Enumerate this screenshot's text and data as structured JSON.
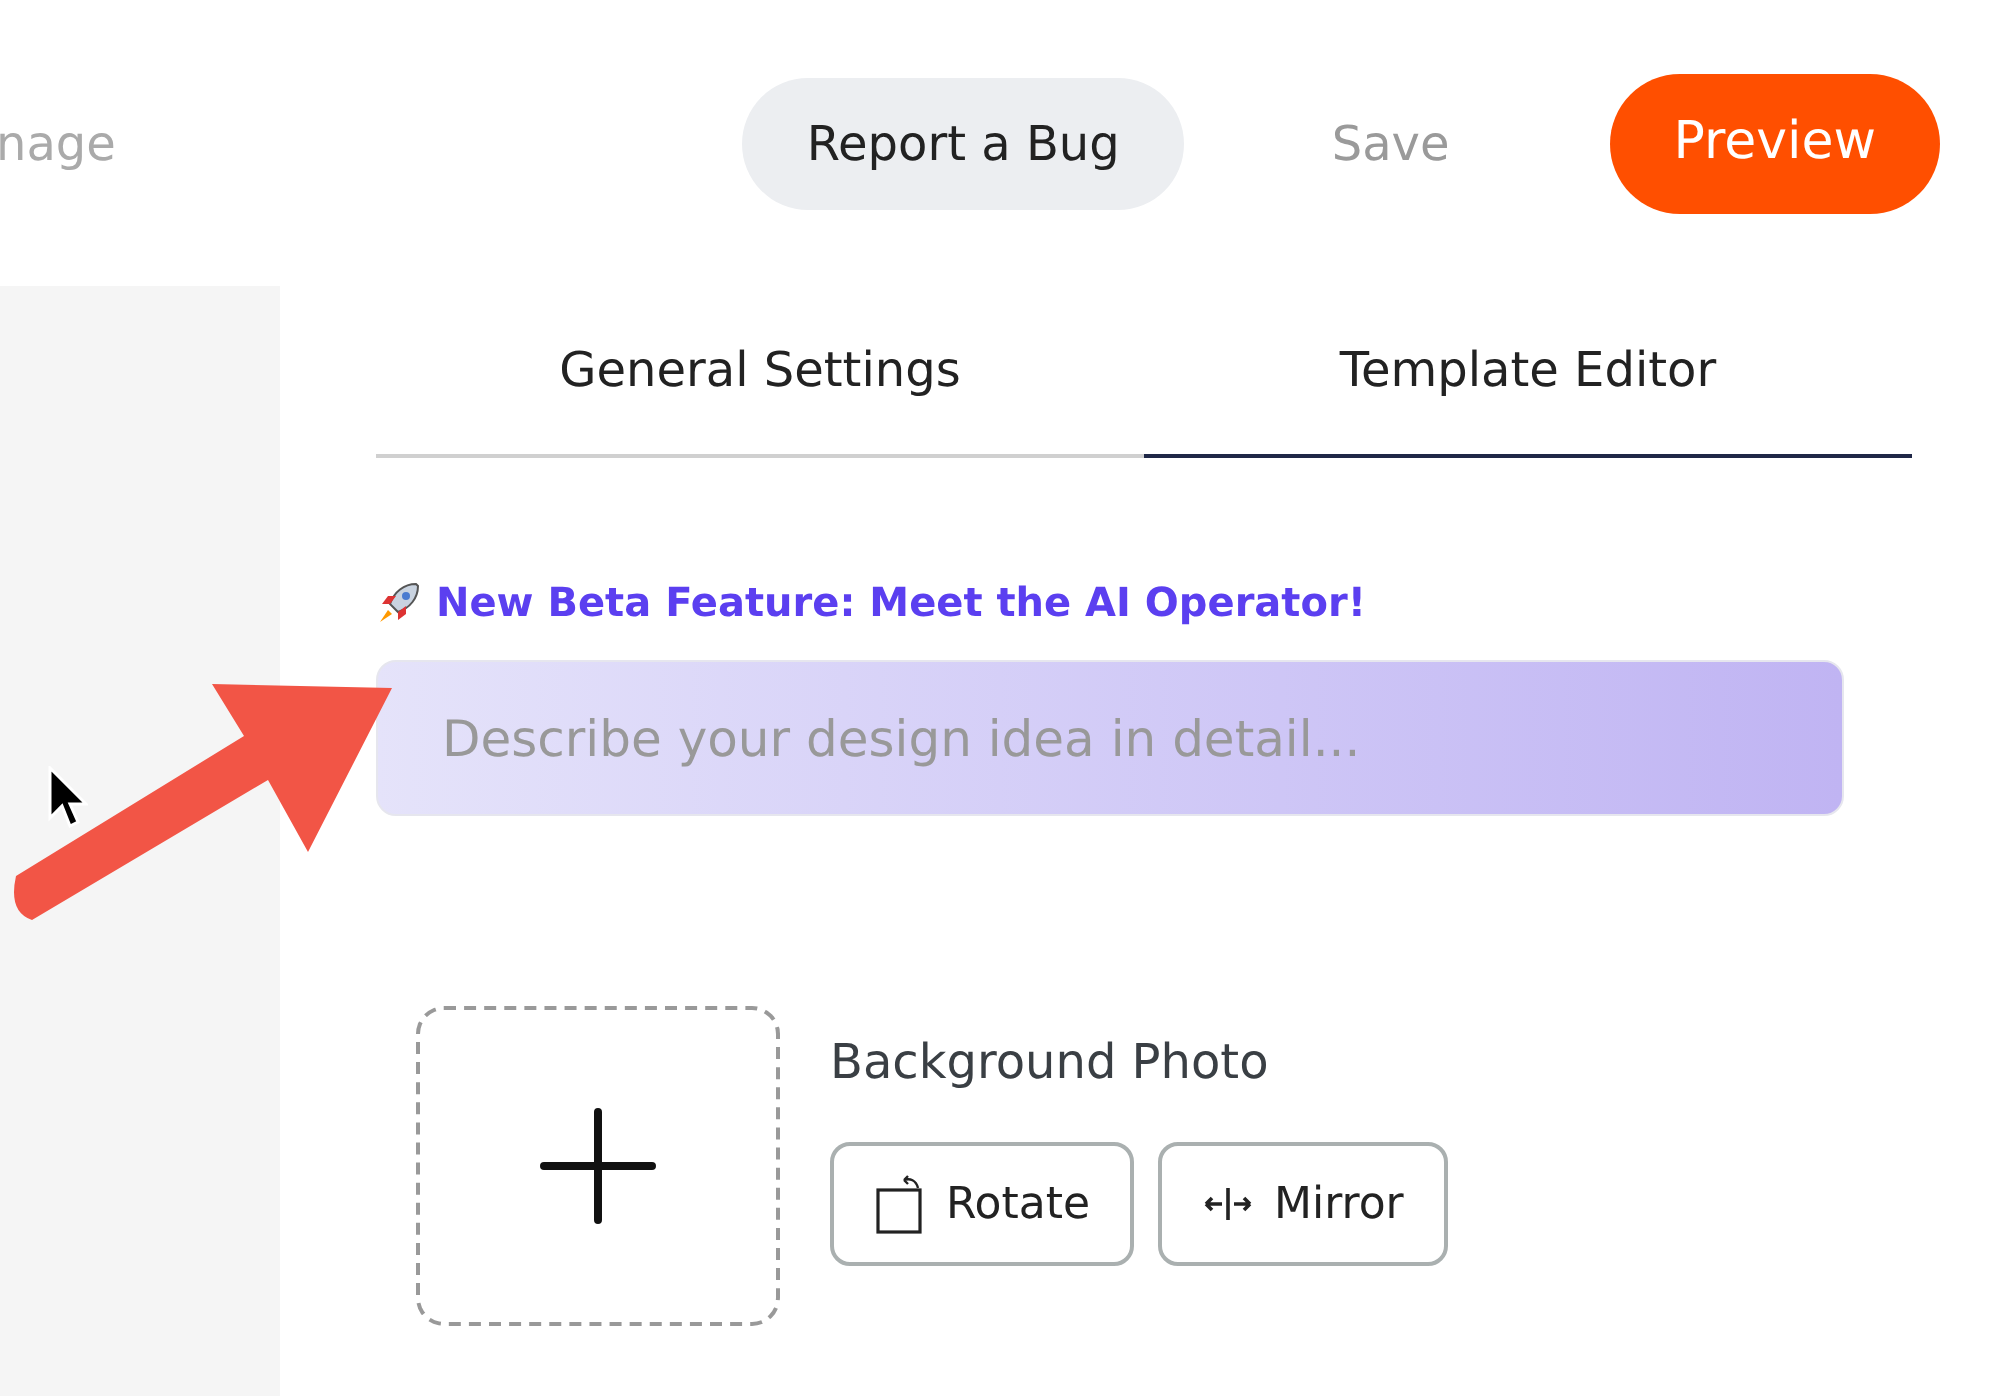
{
  "header": {
    "cut_title": "nage",
    "buttons": [
      {
        "kind": "pill",
        "label": "Report a Bug"
      },
      {
        "kind": "plain",
        "label": "Save"
      },
      {
        "kind": "primary",
        "label": "Preview"
      }
    ]
  },
  "tabs": [
    {
      "label": "General Settings",
      "selected": false
    },
    {
      "label": "Template Editor",
      "selected": true
    }
  ],
  "beta": {
    "label": "New Beta Feature: Meet the AI Operator!",
    "placeholder": "Describe your design idea in detail..."
  },
  "background_photo": {
    "label": "Background Photo",
    "actions": [
      {
        "kind": "rotate",
        "label": "Rotate"
      },
      {
        "kind": "mirror",
        "label": "Mirror"
      }
    ]
  }
}
